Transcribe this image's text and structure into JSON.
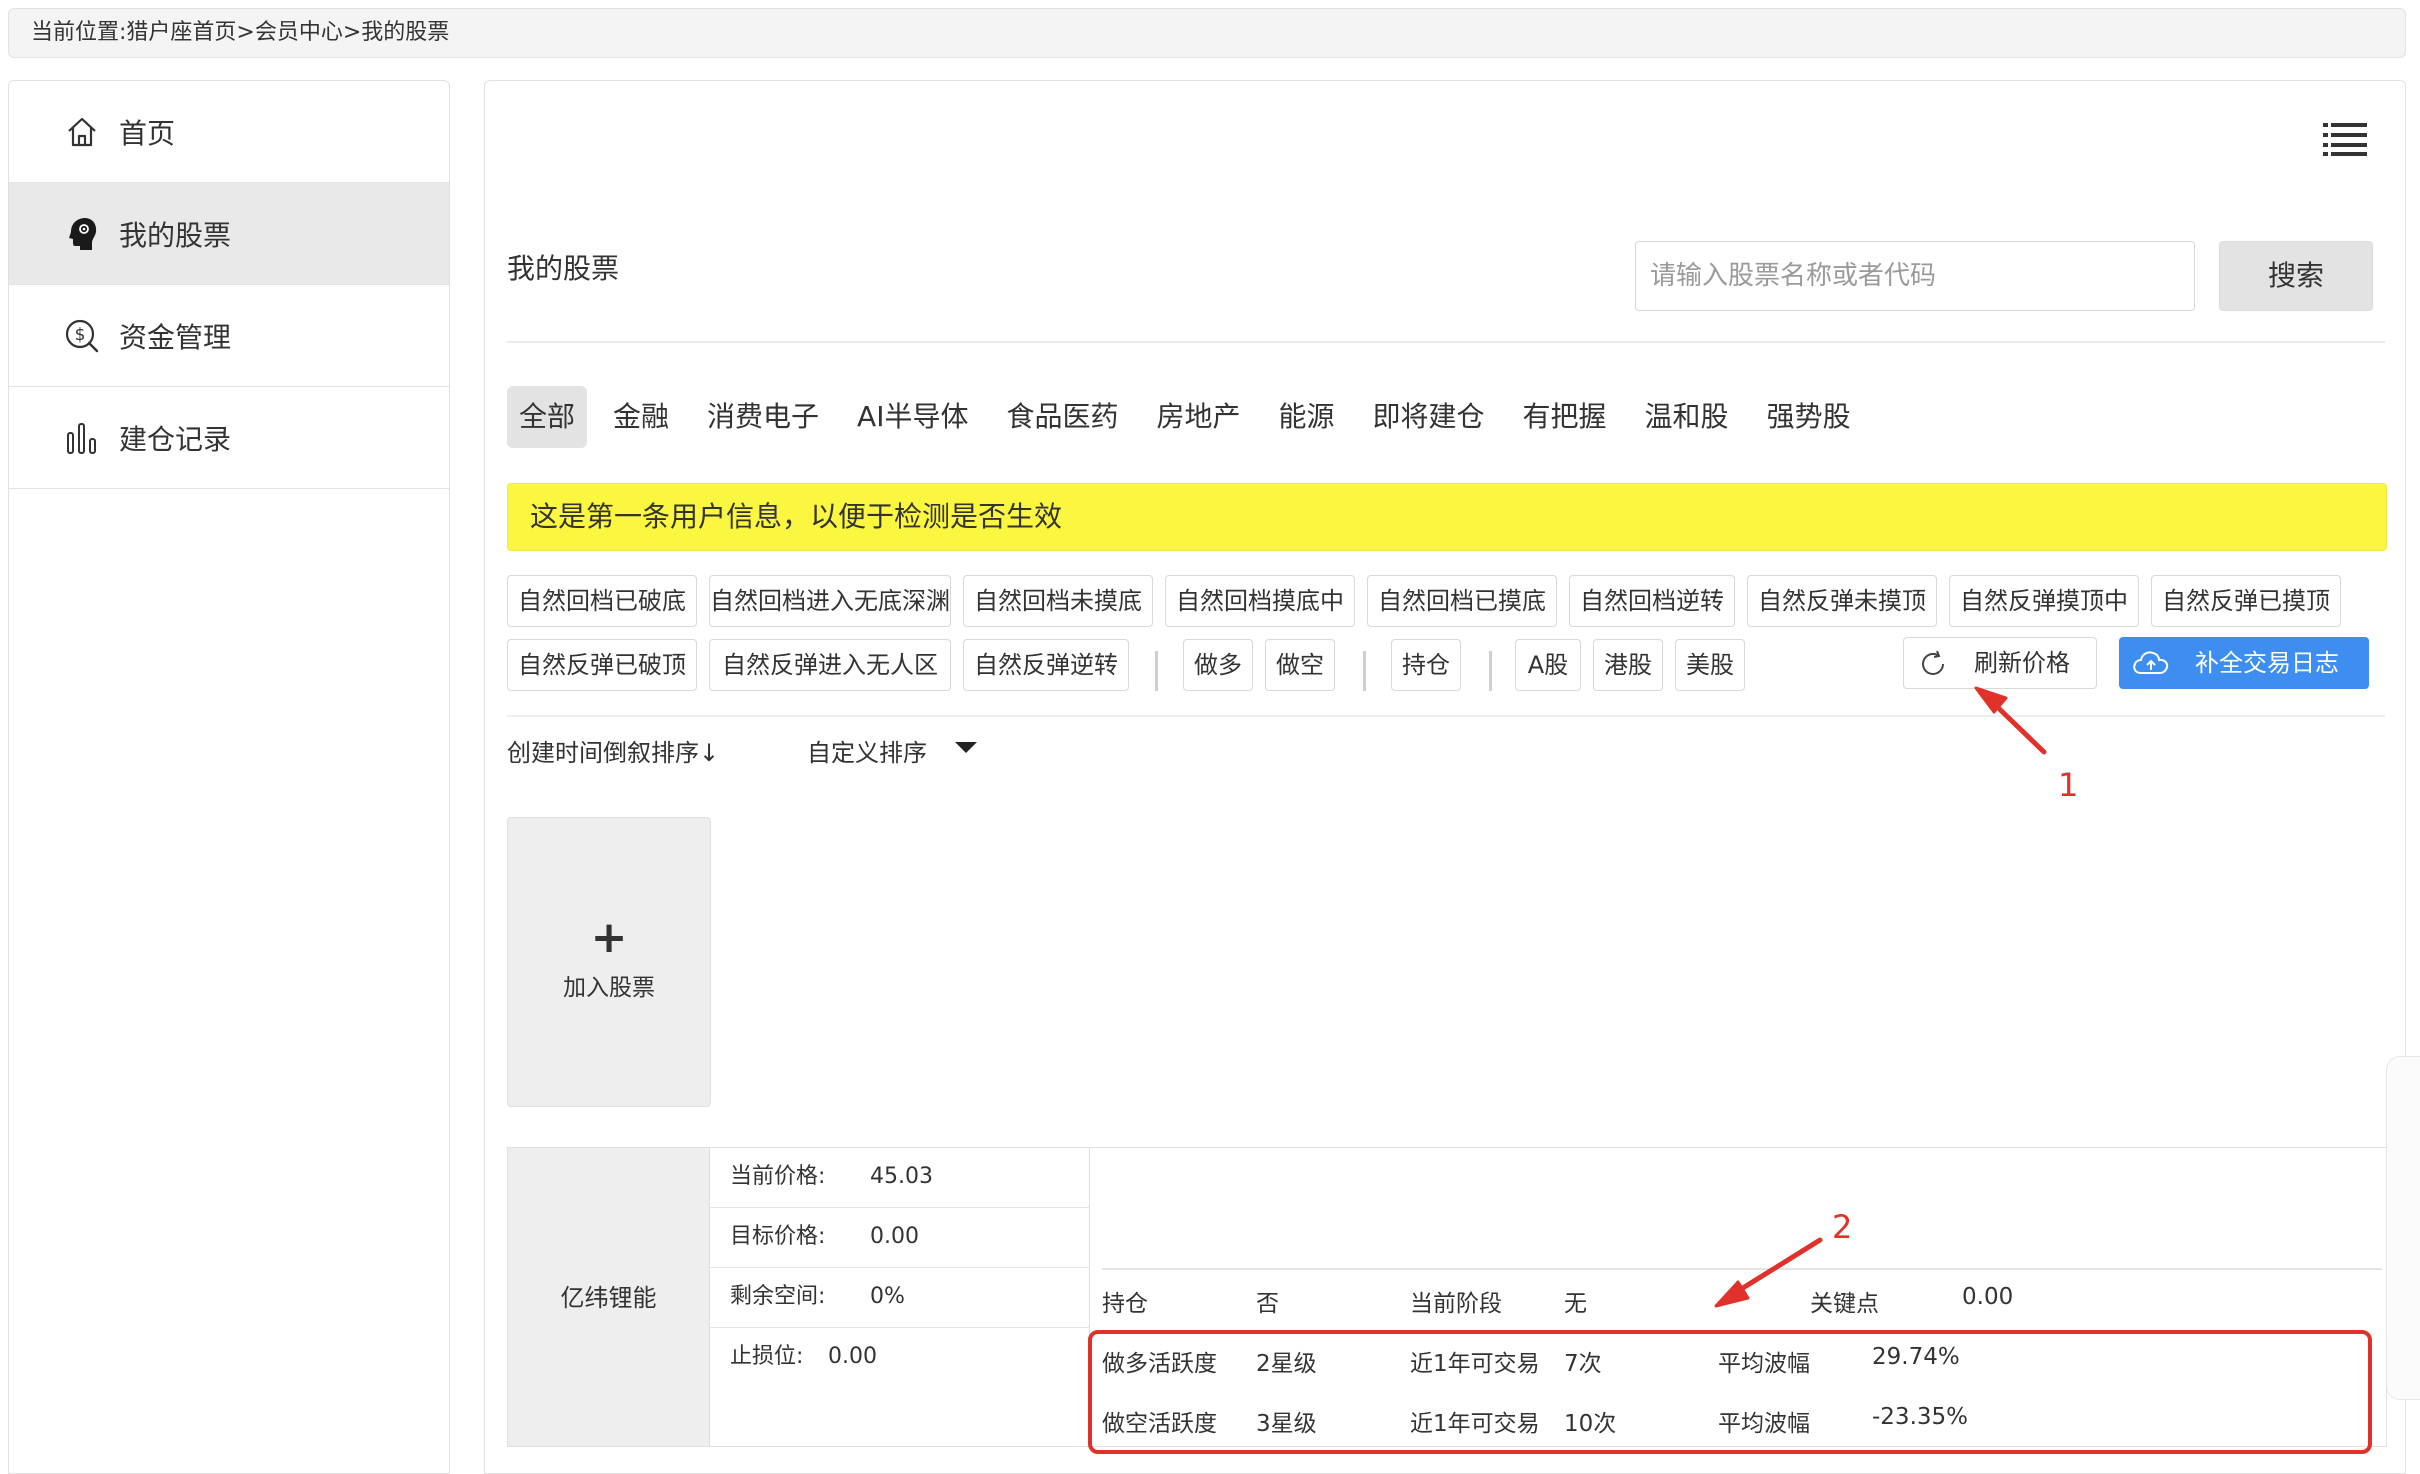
{
  "breadcrumb": "当前位置:猎户座首页>会员中心>我的股票",
  "sidebar": {
    "items": [
      {
        "label": "首页",
        "icon": "home-icon"
      },
      {
        "label": "我的股票",
        "icon": "head-icon",
        "active": true
      },
      {
        "label": "资金管理",
        "icon": "money-icon"
      },
      {
        "label": "建仓记录",
        "icon": "bar-chart-icon"
      }
    ]
  },
  "main": {
    "menu_icon": "list-menu-icon",
    "title": "我的股票",
    "search": {
      "placeholder": "请输入股票名称或者代码",
      "button": "搜索"
    },
    "categories": [
      "全部",
      "金融",
      "消费电子",
      "AI半导体",
      "食品医药",
      "房地产",
      "能源",
      "即将建仓",
      "有把握",
      "温和股",
      "强势股"
    ],
    "active_category": "全部",
    "notice": "这是第一条用户信息，以便于检测是否生效",
    "filters_row1": [
      "自然回档已破底",
      "自然回档进入无底深渊",
      "自然回档未摸底",
      "自然回档摸底中",
      "自然回档已摸底",
      "自然回档逆转",
      "自然反弹未摸顶",
      "自然反弹摸顶中",
      "自然反弹已摸顶"
    ],
    "filters_row2": {
      "trend": [
        "自然反弹已破顶",
        "自然反弹进入无人区",
        "自然反弹逆转"
      ],
      "direction": [
        "做多",
        "做空"
      ],
      "position": [
        "持仓"
      ],
      "market": [
        "A股",
        "港股",
        "美股"
      ]
    },
    "refresh_button": "刷新价格",
    "log_button": "补全交易日志",
    "sort": {
      "time": "创建时间倒叙排序↓",
      "custom": "自定义排序"
    },
    "add_stock": {
      "plus": "+",
      "label": "加入股票"
    },
    "stock": {
      "name": "亿纬锂能",
      "prices": [
        {
          "label": "当前价格:",
          "value": "45.03"
        },
        {
          "label": "目标价格:",
          "value": "0.00"
        },
        {
          "label": "剩余空间:",
          "value": "0%"
        },
        {
          "label": "止损位:",
          "value": "0.00"
        }
      ],
      "info_row1": {
        "k1": "持仓",
        "v1": "否",
        "k2": "当前阶段",
        "v2": "无",
        "k3": "关键点",
        "v3": "0.00"
      },
      "info_row2": {
        "k1": "做多活跃度",
        "v1": "2星级",
        "k2": "近1年可交易",
        "v2": "7次",
        "k3": "平均波幅",
        "v3": "29.74%"
      },
      "info_row3": {
        "k1": "做空活跃度",
        "v1": "3星级",
        "k2": "近1年可交易",
        "v2": "10次",
        "k3": "平均波幅",
        "v3": "-23.35%"
      }
    }
  },
  "annotations": {
    "num1": "1",
    "num2": "2",
    "color": "#e0322b"
  },
  "colors": {
    "notice_bg": "#fbf740",
    "primary_button": "#3d8ef0",
    "annotation": "#e0322b"
  }
}
